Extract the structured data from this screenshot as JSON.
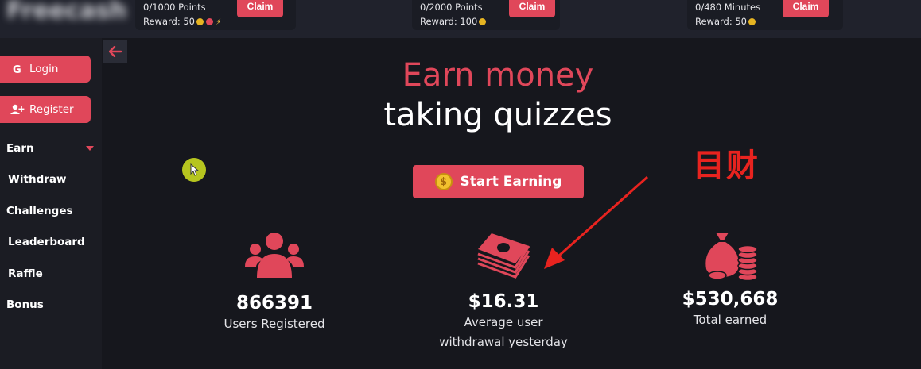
{
  "header": {
    "logo_text": "Freecash",
    "tasks": [
      {
        "progress": "0/1000 Points",
        "reward": "Reward: 50",
        "claim_label": "Claim"
      },
      {
        "progress": "0/2000 Points",
        "reward": "Reward: 100",
        "claim_label": "Claim"
      },
      {
        "progress": "0/480 Minutes",
        "reward": "Reward: 50",
        "claim_label": "Claim"
      }
    ]
  },
  "sidebar": {
    "login_label": "Login",
    "register_label": "Register",
    "items": [
      {
        "label": "Earn"
      },
      {
        "label": "Withdraw"
      },
      {
        "label": "Challenges"
      },
      {
        "label": "Leaderboard"
      },
      {
        "label": "Raffle"
      },
      {
        "label": "Bonus"
      }
    ]
  },
  "hero": {
    "title_red": "Earn money",
    "title_white": "taking quizzes",
    "cta_label": "Start Earning",
    "cta_coin": "$"
  },
  "stats": [
    {
      "value": "866391",
      "label": "Users Registered",
      "icon": "users-icon"
    },
    {
      "value": "$16.31",
      "label_line1": "Average user",
      "label_line2": "withdrawal yesterday",
      "icon": "money-stack-icon"
    },
    {
      "value": "$530,668",
      "label": "Total earned",
      "icon": "money-bag-icon"
    }
  ],
  "annotation": {
    "text": "目财"
  },
  "colors": {
    "accent": "#e0475a",
    "background": "#16171d",
    "sidebar": "#1b1c23",
    "annotation": "#e8231f"
  }
}
